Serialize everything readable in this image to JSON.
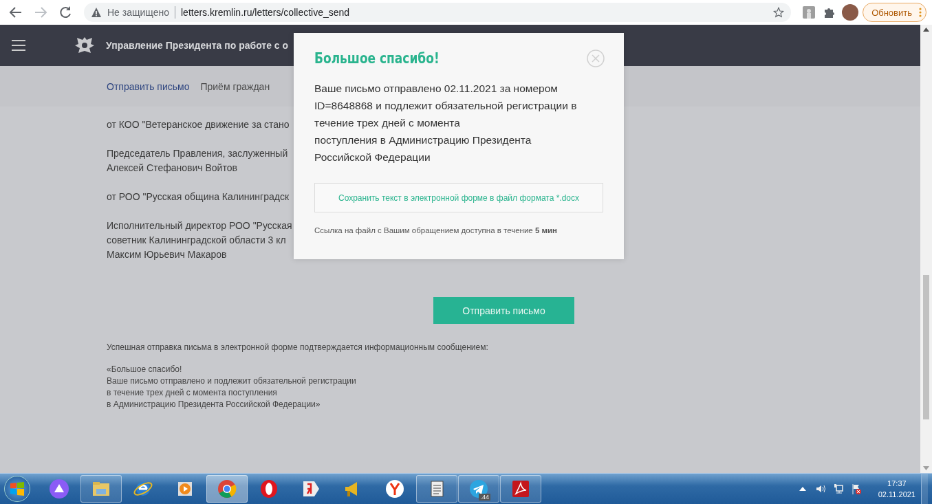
{
  "browser": {
    "security_label": "Не защищено",
    "url": "letters.kremlin.ru/letters/collective_send",
    "update_button": "Обновить"
  },
  "site_header": {
    "title": "Управление Президента по работе с о"
  },
  "nav": [
    {
      "label": "Отправить письмо",
      "selected": true
    },
    {
      "label": "Приём граждан",
      "selected": false
    }
  ],
  "letter_paragraphs": [
    [
      "от КОО \"Ветеранское движение за стано"
    ],
    [
      "Председатель Правления, заслуженный",
      "Алексей Стефанович Войтов"
    ],
    [
      "от РОО \"Русская община Калининградск"
    ],
    [
      "Исполнительный директор РОО \"Русская",
      "советник Калининградской области 3 кл",
      "Максим Юрьевич Макаров"
    ]
  ],
  "submit_button": "Отправить письмо",
  "info": {
    "intro": "Успешная отправка письма в электронной форме подтверждается информационным сообщением:",
    "quote": [
      "«Большое спасибо!",
      "Ваше письмо отправлено и подлежит обязательной регистрации",
      "в течение трех дней с момента поступления",
      "в Администрацию Президента Российской Федерации»"
    ]
  },
  "modal": {
    "title": "Большое спасибо!",
    "message": [
      "Ваше письмо отправлено 02.11.2021 за номером",
      "ID=8648868 и подлежит обязательной регистрации в",
      "течение трех дней с момента",
      "поступления в Администрацию Президента",
      "Российской Федерации"
    ],
    "save_button": "Сохранить текст в электронной форме в файл формата *.docx",
    "note": "Ссылка на файл с Вашим обращением доступна в течение **5 мин**"
  },
  "taskbar": {
    "apps": [
      {
        "kind": "assistant",
        "running": false,
        "selected": false
      },
      {
        "kind": "folder",
        "running": true,
        "selected": false
      },
      {
        "kind": "ie",
        "running": false,
        "selected": false
      },
      {
        "kind": "media",
        "running": false,
        "selected": false
      },
      {
        "kind": "chrome",
        "running": true,
        "selected": true
      },
      {
        "kind": "opera",
        "running": false,
        "selected": false
      },
      {
        "kind": "ya",
        "running": false,
        "selected": false
      },
      {
        "kind": "megaphone",
        "running": false,
        "selected": false
      },
      {
        "kind": "yandex",
        "running": false,
        "selected": false
      },
      {
        "kind": "document",
        "running": true,
        "selected": false
      },
      {
        "kind": "telegram",
        "running": true,
        "selected": false,
        "badge": ".44"
      },
      {
        "kind": "pdf",
        "running": true,
        "selected": false
      }
    ],
    "clock": {
      "time": "17:37",
      "date": "02.11.2021"
    }
  }
}
